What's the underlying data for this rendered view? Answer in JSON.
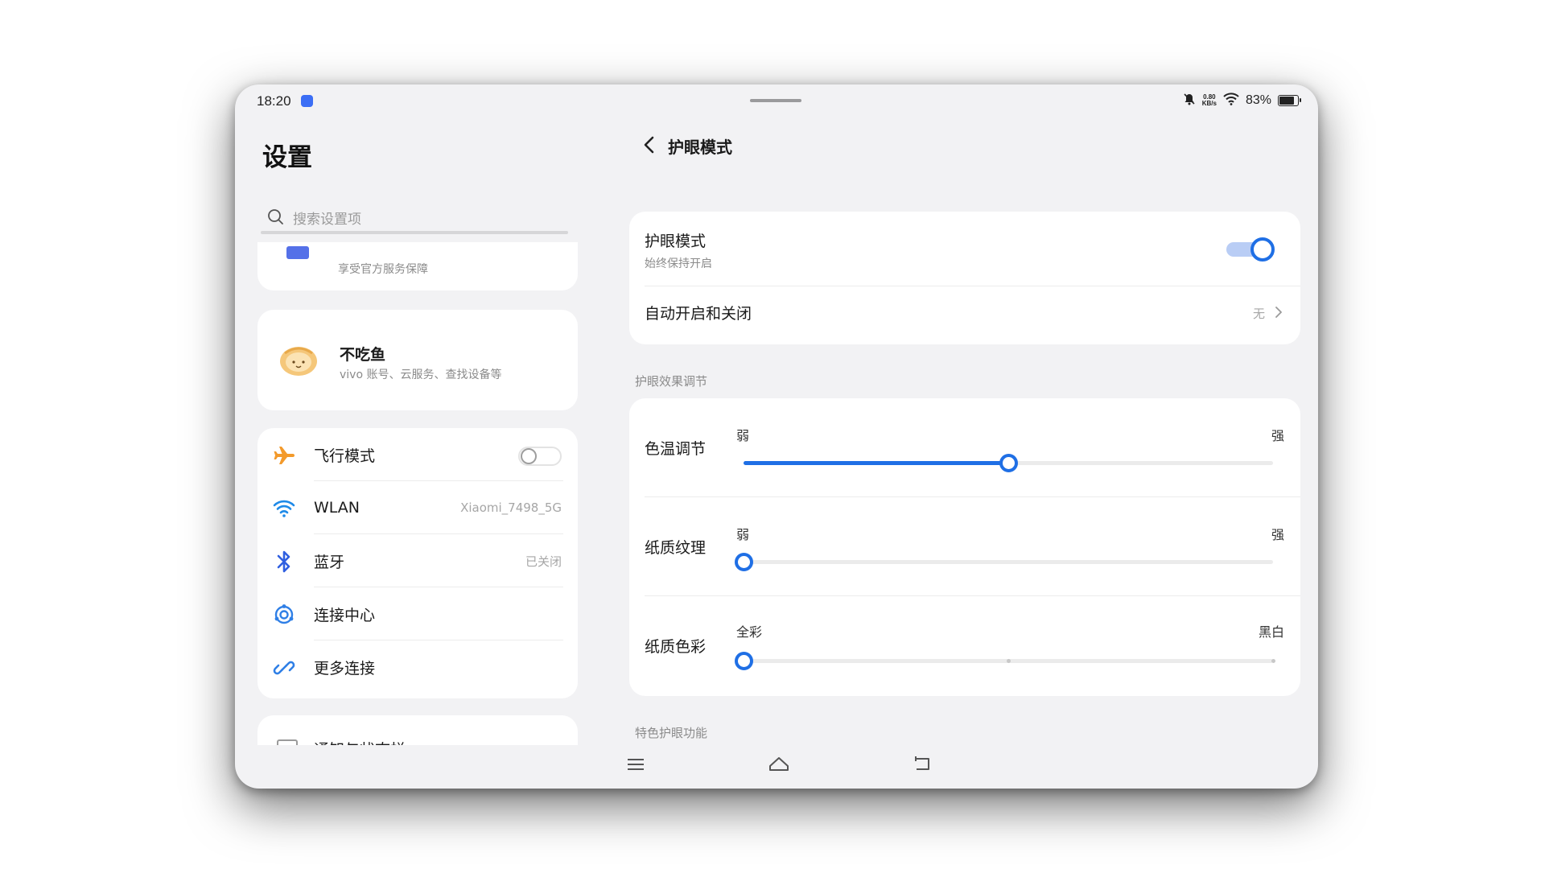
{
  "status": {
    "time": "18:20",
    "net_speed_top": "0.80",
    "net_speed_unit": "KB/s",
    "battery_percent": "83%",
    "battery_level": 0.83
  },
  "settings": {
    "title": "设置",
    "search_placeholder": "搜索设置项",
    "service_card": {
      "subtitle": "享受官方服务保障"
    },
    "account": {
      "name": "不吃鱼",
      "subtitle": "vivo 账号、云服务、查找设备等"
    },
    "connectivity": [
      {
        "label": "飞行模式",
        "value": "",
        "icon": "airplane-icon"
      },
      {
        "label": "WLAN",
        "value": "Xiaomi_7498_5G",
        "icon": "wifi-icon"
      },
      {
        "label": "蓝牙",
        "value": "已关闭",
        "icon": "bluetooth-icon"
      },
      {
        "label": "连接中心",
        "value": "",
        "icon": "connection-center-icon"
      },
      {
        "label": "更多连接",
        "value": "",
        "icon": "link-icon"
      }
    ],
    "notification_item": {
      "label": "通知与状态栏"
    }
  },
  "eye_care": {
    "title": "护眼模式",
    "toggle_title": "护眼模式",
    "toggle_subtitle": "始终保持开启",
    "toggle_on": true,
    "auto_label": "自动开启和关闭",
    "auto_value": "无",
    "section_adjust": "护眼效果调节",
    "sliders": [
      {
        "name": "色温调节",
        "min_label": "弱",
        "max_label": "强",
        "value": 0.5
      },
      {
        "name": "纸质纹理",
        "min_label": "弱",
        "max_label": "强",
        "value": 0.0
      },
      {
        "name": "纸质色彩",
        "min_label": "全彩",
        "max_label": "黑白",
        "value": 0.0
      }
    ],
    "section_special": "特色护眼功能"
  },
  "colors": {
    "accent": "#1f6fe5",
    "airplane": "#f39a2b",
    "background": "#f2f2f4"
  }
}
